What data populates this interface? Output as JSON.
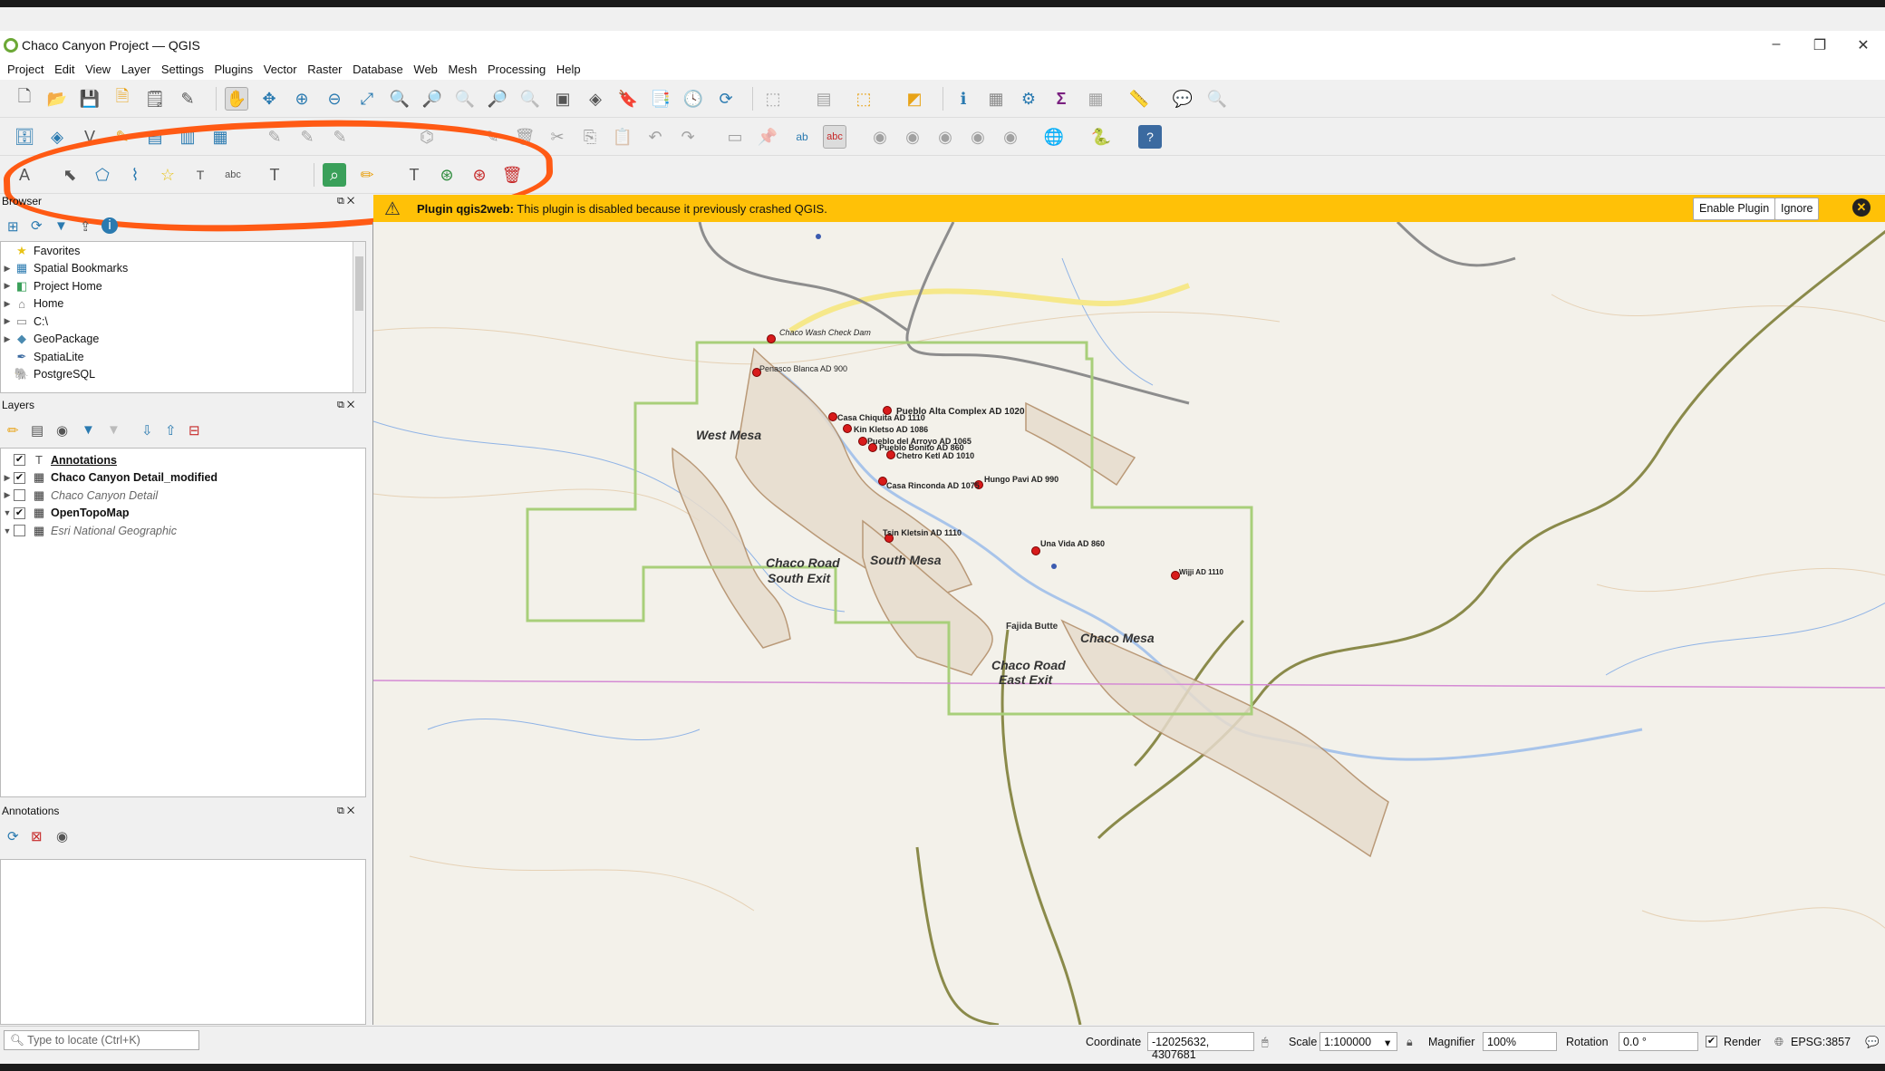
{
  "window": {
    "title": "Chaco Canyon Project — QGIS",
    "minimize": "–",
    "restore": "❐",
    "close": "✕"
  },
  "menu": [
    "Project",
    "Edit",
    "View",
    "Layer",
    "Settings",
    "Plugins",
    "Vector",
    "Raster",
    "Database",
    "Web",
    "Mesh",
    "Processing",
    "Help"
  ],
  "browser": {
    "title": "Browser",
    "items": [
      {
        "label": "Favorites",
        "icon": "star-icon"
      },
      {
        "label": "Spatial Bookmarks",
        "icon": "bookmark-icon"
      },
      {
        "label": "Project Home",
        "icon": "project-home-icon"
      },
      {
        "label": "Home",
        "icon": "home-folder-icon"
      },
      {
        "label": "C:\\",
        "icon": "drive-icon"
      },
      {
        "label": "GeoPackage",
        "icon": "geopackage-icon"
      },
      {
        "label": "SpatiaLite",
        "icon": "spatialite-icon"
      },
      {
        "label": "PostgreSQL",
        "icon": "postgresql-icon"
      }
    ]
  },
  "layers": {
    "title": "Layers",
    "items": [
      {
        "label": "Annotations",
        "checked": true,
        "style": "bold-underline"
      },
      {
        "label": "Chaco Canyon Detail_modified",
        "checked": true,
        "style": "bold"
      },
      {
        "label": "Chaco Canyon Detail",
        "checked": false,
        "style": "italic"
      },
      {
        "label": "OpenTopoMap",
        "checked": true,
        "style": "bold"
      },
      {
        "label": "Esri National Geographic",
        "checked": false,
        "style": "italic"
      }
    ]
  },
  "annotations_panel": {
    "title": "Annotations"
  },
  "warning": {
    "plugin": "Plugin qgis2web:",
    "message": "This plugin is disabled because it previously crashed QGIS.",
    "enable_label": "Enable Plugin",
    "ignore_label": "Ignore"
  },
  "map": {
    "sites": [
      "Chaco Wash Check Dam",
      "Penasco Blanca AD 900",
      "Pueblo Alta Complex AD 1020",
      "Casa Chiquita AD 1110",
      "Kin Kletso AD 1086",
      "Pueblo del Arroyo AD 1065",
      "Pueblo Bonito AD 860",
      "Chetro Ketl AD 1010",
      "Casa Rinconda AD 1075",
      "Hungo Pavi AD 990",
      "Tsin Kletsin AD 1110",
      "Una Vida AD 860",
      "Wijji AD 1110"
    ],
    "areas": [
      "West Mesa",
      "South Mesa",
      "Chaco Road",
      "South Exit",
      "Chaco Mesa",
      "Chaco Road",
      "East Exit",
      "Fajida Butte"
    ]
  },
  "status": {
    "locate_placeholder": "Type to locate (Ctrl+K)",
    "coordinate_label": "Coordinate",
    "coordinate_value": "-12025632, 4307681",
    "scale_label": "Scale",
    "scale_value": "1:100000",
    "magnifier_label": "Magnifier",
    "magnifier_value": "100%",
    "rotation_label": "Rotation",
    "rotation_value": "0.0 °",
    "render_label": "Render",
    "crs": "EPSG:3857"
  },
  "colors": {
    "highlight": "#ff5a14",
    "warning_bar": "#ffc107",
    "site_marker": "#d81b1b",
    "park_boundary": "#a8cf7a",
    "road": "#8a8a4a"
  }
}
